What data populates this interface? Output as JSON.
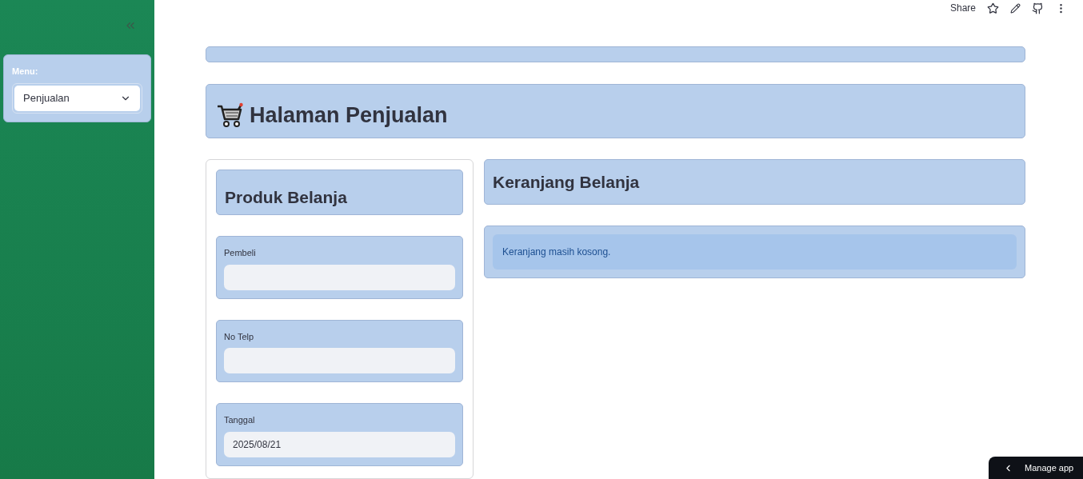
{
  "sidebar": {
    "menu_label": "Menu:",
    "menu_value": "Penjualan"
  },
  "toolbar": {
    "share": "Share"
  },
  "title": "Halaman Penjualan",
  "left_panel": {
    "heading": "Produk Belanja",
    "fields": [
      {
        "label": "Pembeli"
      },
      {
        "label": "No Telp"
      },
      {
        "label": "Tanggal",
        "value": "2025/08/21"
      }
    ]
  },
  "right_panel": {
    "heading": "Keranjang Belanja",
    "message": "Keranjang masih kosong."
  },
  "manage_app": "Manage app"
}
